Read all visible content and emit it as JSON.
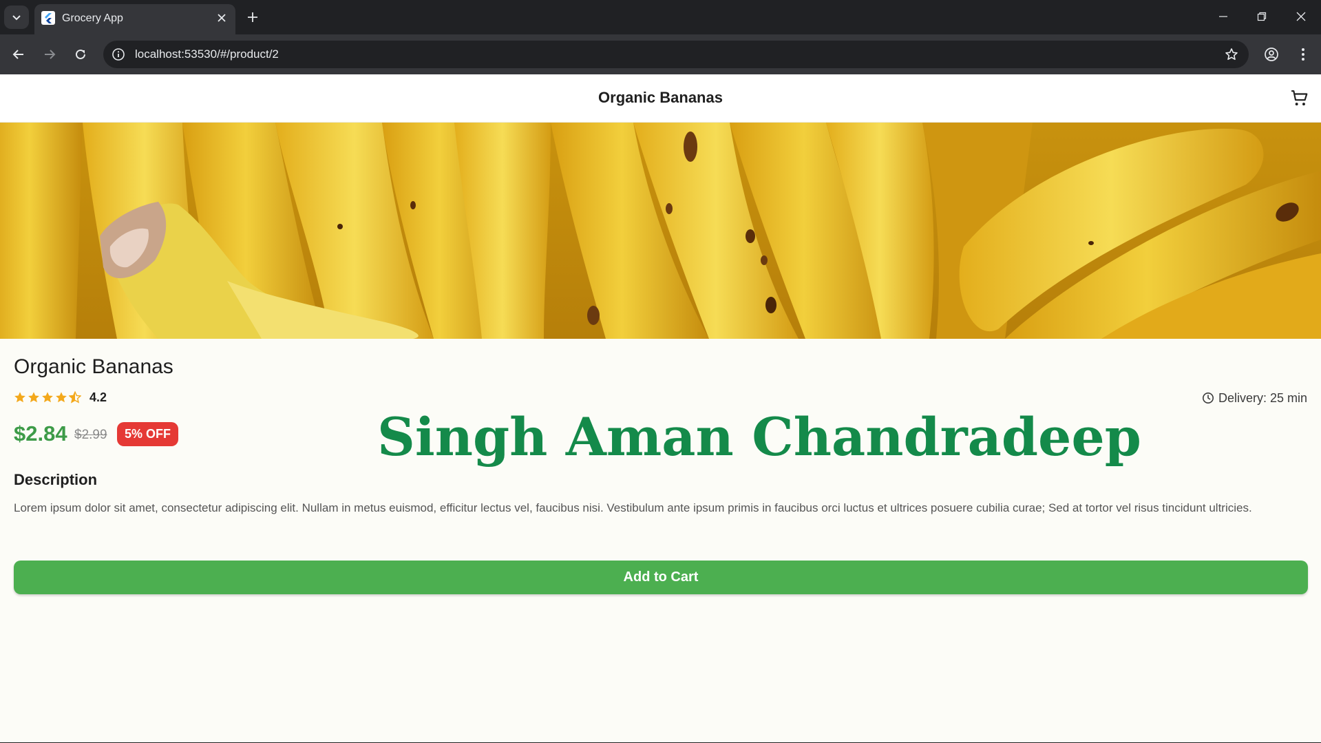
{
  "browser": {
    "tab_title": "Grocery App",
    "url": "localhost:53530/#/product/2",
    "icons": {
      "tab_menu": "chevron-down-icon",
      "tab_close": "close-icon",
      "new_tab": "plus-icon",
      "back": "arrow-left-icon",
      "forward": "arrow-right-icon",
      "reload": "reload-icon",
      "site_info": "info-icon",
      "bookmark": "star-icon",
      "profile": "account-circle-icon",
      "menu": "more-vertical-icon"
    }
  },
  "app": {
    "appbar_title": "Organic Bananas",
    "cart_icon": "cart-icon",
    "product": {
      "name": "Organic Bananas",
      "rating": "4.2",
      "rating_value": 4.2,
      "rating_max": 5,
      "delivery": "Delivery: 25 min",
      "price": "$2.84",
      "old_price": "$2.99",
      "discount": "5% OFF",
      "description_title": "Description",
      "description": "Lorem ipsum dolor sit amet, consectetur adipiscing elit. Nullam in metus euismod, efficitur lectus vel, faucibus nisi. Vestibulum ante ipsum primis in faucibus orci luctus et ultrices posuere cubilia curae; Sed at tortor vel risus tincidunt ultricies.",
      "add_to_cart": "Add to Cart"
    },
    "watermark": "Singh Aman Chandradeep"
  },
  "colors": {
    "price_green": "#3d9b48",
    "button_green": "#4caf50",
    "discount_red": "#e53935",
    "star_gold": "#f3a81b",
    "watermark_green": "#148a4a"
  }
}
